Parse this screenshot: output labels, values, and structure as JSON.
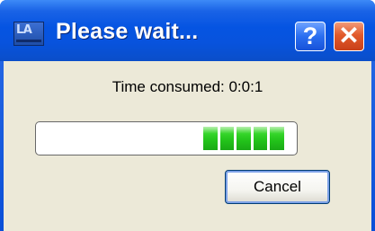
{
  "window": {
    "title": "Please wait...",
    "icon_text": "LA",
    "icon": "app-icon",
    "help_button": "?",
    "close_button": "✕"
  },
  "status": {
    "text": "Time consumed: 0:0:1"
  },
  "progress": {
    "mode": "marquee",
    "visible_chunks": 5,
    "chunk_color": "#22c21a",
    "active_segment_fraction": [
      0.65,
      0.97
    ]
  },
  "buttons": {
    "cancel_label": "Cancel"
  },
  "colors": {
    "titlebar": "#0554e2",
    "client_background": "#ece9d8",
    "close_button": "#e25a2b",
    "help_button": "#2a6ef0"
  }
}
